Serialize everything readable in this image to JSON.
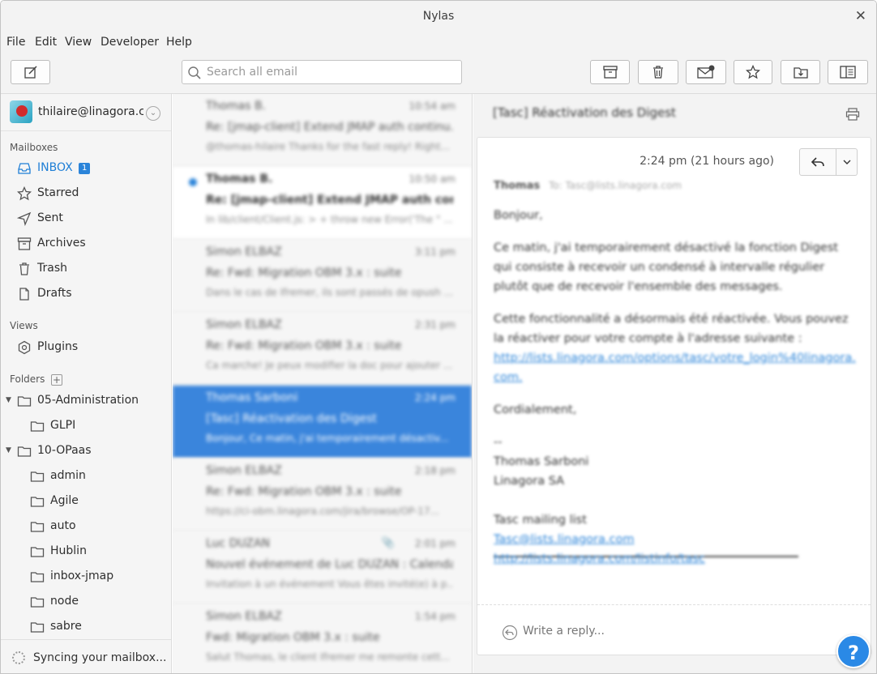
{
  "window": {
    "title": "Nylas",
    "close_glyph": "✕"
  },
  "menu": [
    "File",
    "Edit",
    "View",
    "Developer",
    "Help"
  ],
  "toolbar": {
    "search_placeholder": "Search all email",
    "icons": [
      "compose-icon",
      "archive-icon",
      "trash-icon",
      "mark-unread-icon",
      "star-icon",
      "move-folder-icon",
      "toggle-panel-icon"
    ]
  },
  "account": {
    "email": "thilaire@linagora.c...",
    "chevron": "⌄"
  },
  "mailboxes": {
    "label": "Mailboxes",
    "items": [
      {
        "label": "INBOX",
        "badge": "1",
        "icon": "inbox-icon"
      },
      {
        "label": "Starred",
        "icon": "star-icon"
      },
      {
        "label": "Sent",
        "icon": "sent-icon"
      },
      {
        "label": "Archives",
        "icon": "archive-icon"
      },
      {
        "label": "Trash",
        "icon": "trash-icon"
      },
      {
        "label": "Drafts",
        "icon": "drafts-icon"
      }
    ]
  },
  "views": {
    "label": "Views",
    "items": [
      {
        "label": "Plugins",
        "icon": "plugins-icon"
      }
    ]
  },
  "folders": {
    "label": "Folders",
    "add": "+",
    "items": [
      {
        "label": "05-Administration",
        "expanded": true
      },
      {
        "label": "GLPI"
      },
      {
        "label": "10-OPaas",
        "expanded": true
      },
      {
        "label": "admin"
      },
      {
        "label": "Agile"
      },
      {
        "label": "auto"
      },
      {
        "label": "Hublin"
      },
      {
        "label": "inbox-jmap"
      },
      {
        "label": "node"
      },
      {
        "label": "sabre"
      }
    ],
    "toggle_glyph": "▼"
  },
  "sync": {
    "text": "Syncing your mailbox..."
  },
  "messages": [
    {
      "from": "Thomas B.",
      "time": "10:54 am",
      "subject": "Re: [jmap-client] Extend JMAP auth continu...",
      "snippet": "@thomas-hilaire Thanks for the fast reply! Right..."
    },
    {
      "from": "Thomas B.",
      "time": "10:50 am",
      "subject": "Re: [jmap-client] Extend JMAP auth conti...",
      "snippet": "In lib/client/Client.js: > + throw new Error('The \" ...",
      "unread": true
    },
    {
      "from": "Simon ELBAZ",
      "time": "3:11 pm",
      "subject": "Re: Fwd: Migration OBM 3.x : suite",
      "snippet": "Dans le cas de Ifremer, ils sont passés de opush ..."
    },
    {
      "from": "Simon ELBAZ",
      "time": "2:31 pm",
      "subject": "Re: Fwd: Migration OBM 3.x : suite",
      "snippet": "Ca marche! Je peux modifier la doc pour ajouter ..."
    },
    {
      "from": "Thomas Sarboni",
      "time": "2:24 pm",
      "subject": "[Tasc] Réactivation des Digest",
      "snippet": "Bonjour, Ce matin, j'ai temporairement désactiv...",
      "selected": true
    },
    {
      "from": "Simon ELBAZ",
      "time": "2:18 pm",
      "subject": "Re: Fwd: Migration OBM 3.x : suite",
      "snippet": "https://ci-obm.linagora.com/jira/browse/OP-17..."
    },
    {
      "from": "Luc DUZAN",
      "time": "2:01 pm",
      "subject": "Nouvel événement de Luc DUZAN : Calendar...",
      "snippet": "Invitation à un événement Vous êtes invité(e) à p...",
      "attachment": true
    },
    {
      "from": "Simon ELBAZ",
      "time": "1:54 pm",
      "subject": "Fwd: Migration OBM 3.x : suite",
      "snippet": "Salut Thomas, le client Ifremer me remonte cett..."
    }
  ],
  "reader": {
    "subject": "[Tasc] Réactivation des Digest",
    "time": "2:24 pm (21 hours ago)",
    "from": "Thomas",
    "to": "To: Tasc@lists.linagora.com",
    "greeting": "Bonjour,",
    "p1": "Ce matin, j'ai temporairement désactivé la fonction Digest qui consiste à recevoir un condensé à intervalle régulier plutôt que de recevoir l'ensemble des messages.",
    "p2": "Cette fonctionnalité a désormais été réactivée. Vous pouvez la réactiver pour votre compte à l'adresse suivante :",
    "link1": "http://lists.linagora.com/options/tasc/votre_login%40linagora.com.",
    "closing": "Cordialement,",
    "sig_dash": "--",
    "sig_name": "Thomas Sarboni",
    "sig_company": "Linagora SA",
    "list_label": "Tasc mailing list",
    "list_email": "Tasc@lists.linagora.com",
    "list_url": "http://lists.linagora.com/listinfo/tasc",
    "reply_placeholder": "Write a reply..."
  },
  "help": {
    "label": "?"
  }
}
